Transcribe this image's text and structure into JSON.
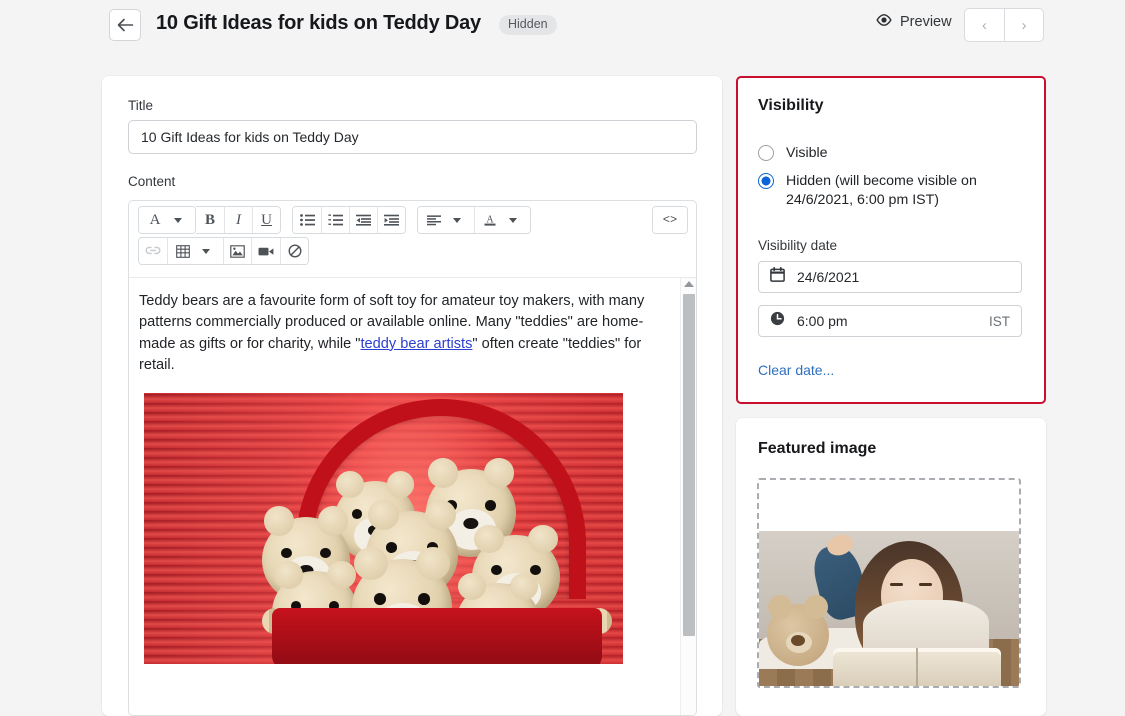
{
  "header": {
    "back_icon": "arrow-left-icon",
    "title": "10 Gift Ideas for kids on Teddy Day",
    "status_badge": "Hidden",
    "preview_label": "Preview",
    "preview_icon": "eye-icon",
    "prev_icon": "‹",
    "next_icon": "›"
  },
  "editor": {
    "title_label": "Title",
    "title_value": "10 Gift Ideas for kids on Teddy Day",
    "title_placeholder": "Title",
    "content_label": "Content",
    "toolbar_row1": [
      {
        "name": "font-family-icon",
        "glyph": "A",
        "caret": true
      },
      {
        "name": "bold-icon",
        "glyph": "B"
      },
      {
        "name": "italic-icon",
        "glyph": "I"
      },
      {
        "name": "underline-icon",
        "glyph": "U"
      },
      {
        "name": "unordered-list-icon",
        "glyph": "☰"
      },
      {
        "name": "ordered-list-icon",
        "glyph": "☰"
      },
      {
        "name": "outdent-icon",
        "glyph": "☰"
      },
      {
        "name": "indent-icon",
        "glyph": "☰"
      },
      {
        "name": "align-icon",
        "glyph": "≡",
        "caret": true
      },
      {
        "name": "text-color-icon",
        "glyph": "A",
        "caret": true
      },
      {
        "name": "source-code-icon",
        "glyph": "<>"
      }
    ],
    "toolbar_row2": [
      {
        "name": "link-icon",
        "glyph": "⚭"
      },
      {
        "name": "table-icon",
        "glyph": "▦",
        "caret": true
      },
      {
        "name": "image-icon",
        "glyph": "Ὓc"
      },
      {
        "name": "video-icon",
        "glyph": "▶"
      },
      {
        "name": "clear-formatting-icon",
        "glyph": "⃠"
      }
    ],
    "body_part1": "Teddy bears are a favourite form of soft toy for amateur toy makers, with many patterns commercially produced or available online. Many \"teddies\" are home-made as gifts or for charity, while \"",
    "body_link": "teddy bear artists",
    "body_part2": "\" often create \"teddies\" for retail.",
    "body_image_alt": "teddy-bears-in-red-basket"
  },
  "visibility": {
    "heading": "Visibility",
    "options": [
      {
        "label": "Visible",
        "selected": false
      },
      {
        "label": "Hidden (will become visible on 24/6/2021, 6:00 pm IST)",
        "selected": true
      }
    ],
    "date_label": "Visibility date",
    "date_value": "24/6/2021",
    "date_icon": "calendar-icon",
    "time_value": "6:00 pm",
    "time_icon": "clock-icon",
    "timezone": "IST",
    "clear_link": "Clear date...",
    "highlight_color": "#c8102e",
    "accent_color": "#0b64d6"
  },
  "featured": {
    "heading": "Featured image",
    "image_alt": "girl-reading-book-with-teddy-bear"
  }
}
